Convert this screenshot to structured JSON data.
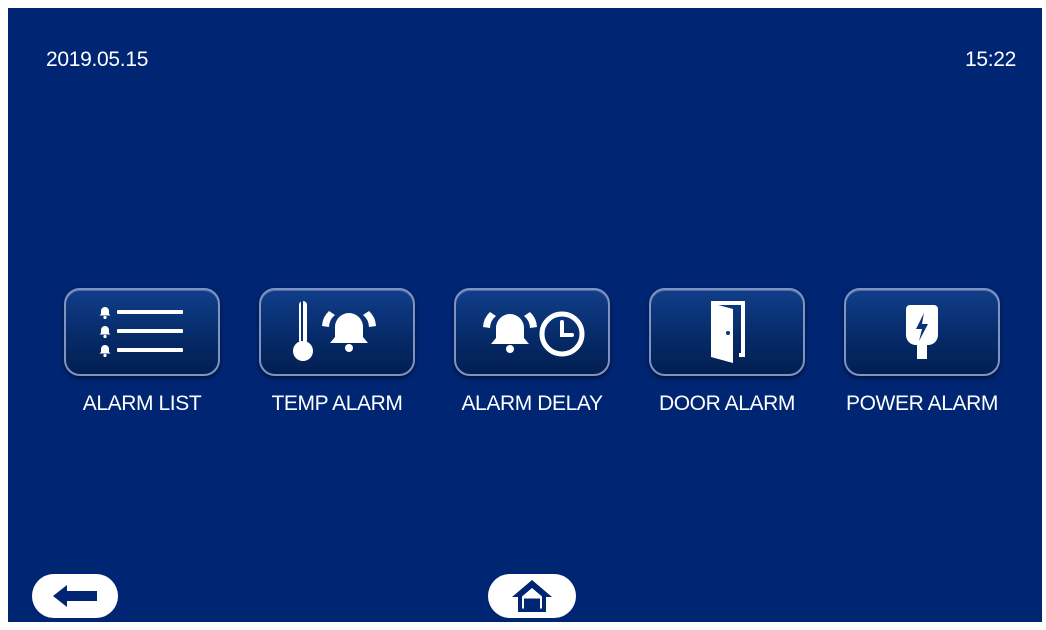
{
  "status_bar": {
    "date": "2019.05.15",
    "time": "15:22"
  },
  "menu": {
    "items": [
      {
        "label": "ALARM LIST",
        "icon": "list-icon"
      },
      {
        "label": "TEMP ALARM",
        "icon": "thermometer-alarm-icon"
      },
      {
        "label": "ALARM DELAY",
        "icon": "alarm-clock-icon"
      },
      {
        "label": "DOOR ALARM",
        "icon": "door-icon"
      },
      {
        "label": "POWER ALARM",
        "icon": "power-plug-icon"
      }
    ]
  },
  "navigation": {
    "back_icon": "back-arrow-icon",
    "home_icon": "home-icon"
  },
  "colors": {
    "background": "#002573",
    "tile_border": "#7f93c2",
    "text": "#ffffff"
  }
}
